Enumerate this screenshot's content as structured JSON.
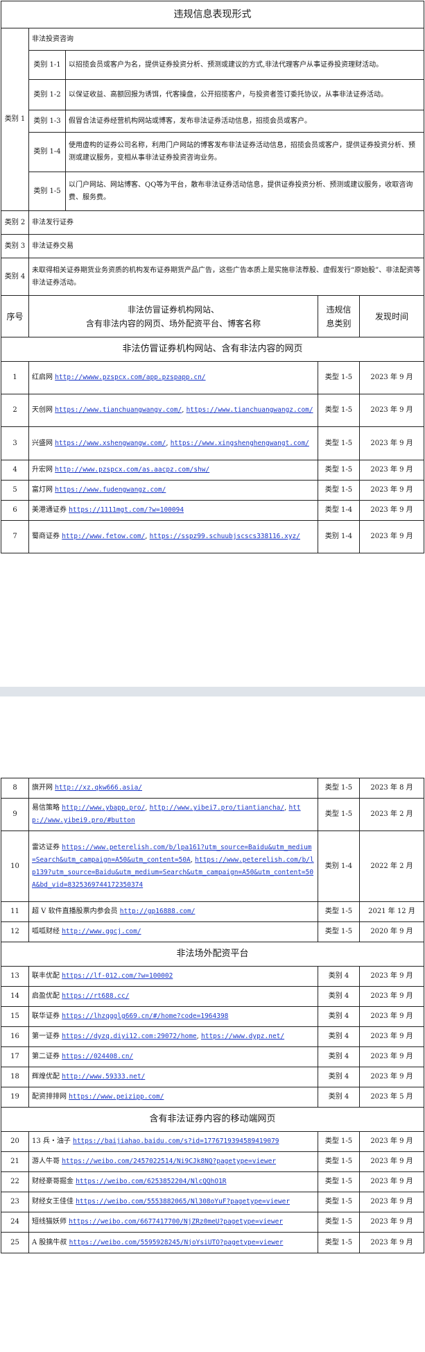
{
  "title": "违规信息表现形式",
  "category1": {
    "label": "类别 1",
    "heading": "非法投资咨询",
    "items": [
      {
        "label": "类别 1-1",
        "text": "以招揽会员或客户为名，提供证券投资分析、预测或建议的方式,非法代理客户从事证券投资理财活动。"
      },
      {
        "label": "类别 1-2",
        "text": "以保证收益、高额回报为诱饵，代客操盘，公开招揽客户，与投资者签订委托协议，从事非法证券活动。"
      },
      {
        "label": "类别 1-3",
        "text": "假冒合法证券经营机构网站或博客，发布非法证券活动信息，招揽会员或客户。"
      },
      {
        "label": "类别 1-4",
        "text": "使用虚构的证券公司名称，利用门户网站的博客发布非法证券活动信息，招揽会员或客户，提供证券投资分析、预测或建议服务，变相从事非法证券投资咨询业务。"
      },
      {
        "label": "类别 1-5",
        "text": "以门户网站、网站博客、QQ等为平台，散布非法证券活动信息，提供证券投资分析、预测或建议服务，收取咨询费、服务费。"
      }
    ]
  },
  "category2": {
    "label": "类别 2",
    "text": "非法发行证券"
  },
  "category3": {
    "label": "类别 3",
    "text": "非法证券交易"
  },
  "category4": {
    "label": "类别 4",
    "text": "未取得相关证券期货业务资质的机构发布证券期货产品广告，这些广告本质上是实施非法荐股、虚假发行“原始股”、非法配资等非法证券活动。"
  },
  "header": {
    "seq": "序号",
    "name_line1": "非法仿冒证券机构网站、",
    "name_line2": "含有非法内容的网页、场外配资平台、博客名称",
    "type_line1": "违规信",
    "type_line2": "息类别",
    "time": "发现时间"
  },
  "sections": {
    "s1": "非法仿冒证券机构网站、含有非法内容的网页",
    "s2": "非法场外配资平台",
    "s3": "含有非法证券内容的移动端网页"
  },
  "rows": [
    {
      "no": "1",
      "name": "红启网",
      "urls": [
        "http://wwww.pzspcx.com/app.pzspapp.cn/"
      ],
      "type": "类型 1-5",
      "time": "2023 年 9 月"
    },
    {
      "no": "2",
      "name": "天创网",
      "urls": [
        "https://www.tianchuangwangv.com/",
        "https://www.tianchuangwangz.com/"
      ],
      "type": "类型 1-5",
      "time": "2023 年 9 月"
    },
    {
      "no": "3",
      "name": "兴盛网",
      "urls": [
        "https://www.xshengwangw.com/",
        "https://www.xingshenghengwangt.com/"
      ],
      "type": "类型 1-5",
      "time": "2023 年 9 月"
    },
    {
      "no": "4",
      "name": "升宏网",
      "urls": [
        "http://www.pzspcx.com/as.aacpz.com/shw/"
      ],
      "type": "类型 1-5",
      "time": "2023 年 9 月"
    },
    {
      "no": "5",
      "name": "富灯网",
      "urls": [
        "https://www.fudengwangz.com/"
      ],
      "type": "类型 1-5",
      "time": "2023 年 9 月"
    },
    {
      "no": "6",
      "name": "美港通证券",
      "urls": [
        "https://1111mgt.com/?w=100094"
      ],
      "type": "类型 1-4",
      "time": "2023 年 9 月"
    },
    {
      "no": "7",
      "name": "蜀商证券",
      "urls": [
        "http://www.fetow.com/",
        "https://sspz99.schuubjscscs338116.xyz/"
      ],
      "type": "类别 1-4",
      "time": "2023 年 9 月"
    },
    {
      "no": "8",
      "name": "旗开网",
      "urls": [
        "http://xz.qkw666.asia/"
      ],
      "type": "类型 1-5",
      "time": "2023 年 8 月"
    },
    {
      "no": "9",
      "name": "易信策略",
      "urls": [
        "http://www.ybapp.pro/",
        "http://www.yibei7.pro/tiantiancha/",
        "http://www.yibei9.pro/#button"
      ],
      "type": "类型 1-5",
      "time": "2023 年 2 月"
    },
    {
      "no": "10",
      "name": "雷达证券",
      "urls": [
        "https://www.peterelish.com/b/lpa161?utm_source=Baidu&utm_medium=Search&utm_campaign=A50&utm_content=50A",
        "https://www.peterelish.com/b/lp139?utm_source=Baidu&utm_medium=Search&utm_campaign=A50&utm_content=50A&bd_vid=8325369744172350374"
      ],
      "type": "类别 1-4",
      "time": "2022 年 2 月"
    },
    {
      "no": "11",
      "name": "超 V 软件直播股票内参会员",
      "urls": [
        "http://gp16888.com/"
      ],
      "type": "类型 1-5",
      "time": "2021 年 12 月"
    },
    {
      "no": "12",
      "name": "呱呱财经",
      "urls": [
        "http://www.ggcj.com/"
      ],
      "type": "类型 1-5",
      "time": "2020 年 9 月"
    },
    {
      "no": "13",
      "name": "联丰优配",
      "urls": [
        "https://lf-012.com/?w=100002"
      ],
      "type": "类别 4",
      "time": "2023 年 9 月"
    },
    {
      "no": "14",
      "name": "启盈优配",
      "urls": [
        "https://rt688.cc/"
      ],
      "type": "类别 4",
      "time": "2023 年 9 月"
    },
    {
      "no": "15",
      "name": "联华证券",
      "urls": [
        "https://lhzqgglg669.cn/#/home?code=1964398"
      ],
      "type": "类别 4",
      "time": "2023 年 9 月"
    },
    {
      "no": "16",
      "name": "第一证券",
      "urls": [
        "https://dyzq.diyi12.com:29072/home",
        "https://www.dypz.net/"
      ],
      "type": "类别 4",
      "time": "2023 年 9 月"
    },
    {
      "no": "17",
      "name": "第二证券",
      "urls": [
        "https://024408.cn/"
      ],
      "type": "类别 4",
      "time": "2023 年 9 月"
    },
    {
      "no": "18",
      "name": "辉煌优配",
      "urls": [
        "http://www.59333.net/"
      ],
      "type": "类别 4",
      "time": "2023 年 9 月"
    },
    {
      "no": "19",
      "name": "配资排排网",
      "urls": [
        "https://www.peizipp.com/"
      ],
      "type": "类别 4",
      "time": "2023 年 5 月"
    },
    {
      "no": "20",
      "name": "13 兵・油子",
      "urls": [
        "https://baijiahao.baidu.com/s?id=1776719394589419079"
      ],
      "type": "类型 1-5",
      "time": "2023 年 9 月"
    },
    {
      "no": "21",
      "name": "游人牛哥",
      "urls": [
        "https://weibo.com/2457022514/Ni9CJk8NQ?pagetype=viewer"
      ],
      "type": "类型 1-5",
      "time": "2023 年 9 月"
    },
    {
      "no": "22",
      "name": "财经豪哥掘金",
      "urls": [
        "https://weibo.com/6253852204/NlcQQhO1R"
      ],
      "type": "类型 1-5",
      "time": "2023 年 9 月"
    },
    {
      "no": "23",
      "name": "财经女王佳佳",
      "urls": [
        "https://weibo.com/5553882065/Nl308oYuF?pagetype=viewer"
      ],
      "type": "类型 1-5",
      "time": "2023 年 9 月"
    },
    {
      "no": "24",
      "name": "短线猫妖师",
      "urls": [
        "https://weibo.com/6677417700/NjZRz0meU?pagetype=viewer"
      ],
      "type": "类型 1-5",
      "time": "2023 年 9 月"
    },
    {
      "no": "25",
      "name": "A 股擒牛叔",
      "urls": [
        "https://weibo.com/5595928245/NjoYsiUTO?pagetype=viewer"
      ],
      "type": "类型 1-5",
      "time": "2023 年 9 月"
    }
  ]
}
